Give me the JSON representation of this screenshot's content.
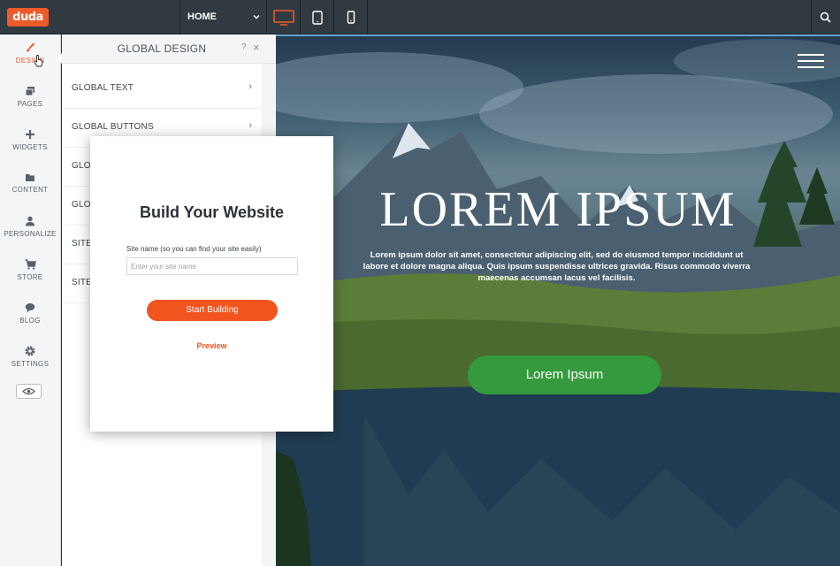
{
  "brand": {
    "logo_text": "duda",
    "accent": "#ef5a2a"
  },
  "topbar": {
    "page_select": "HOME",
    "devices": [
      "desktop-icon",
      "tablet-icon",
      "mobile-icon"
    ],
    "active_device": "desktop"
  },
  "sidebar": {
    "items": [
      {
        "label": "DESIGN",
        "icon": "brush-icon",
        "active": true
      },
      {
        "label": "PAGES",
        "icon": "pages-icon"
      },
      {
        "label": "WIDGETS",
        "icon": "plus-icon"
      },
      {
        "label": "CONTENT",
        "icon": "folder-icon"
      },
      {
        "label": "PERSONALIZE",
        "icon": "person-icon"
      },
      {
        "label": "STORE",
        "icon": "cart-icon"
      },
      {
        "label": "BLOG",
        "icon": "chat-icon"
      },
      {
        "label": "SETTINGS",
        "icon": "gear-icon"
      }
    ]
  },
  "panel": {
    "title": "GLOBAL DESIGN",
    "help": "?",
    "close": "×",
    "rows": [
      "GLOBAL TEXT",
      "GLOBAL BUTTONS",
      "GLOB",
      "GLOB",
      "SITE",
      "SITE"
    ],
    "arrow": "›"
  },
  "modal": {
    "title": "Build Your Website",
    "field_label": "Site name (so you can find your site easily)",
    "field_placeholder": "Enter your site name",
    "start_button": "Start Building",
    "preview_link": "Preview"
  },
  "hero": {
    "title": "LOREM IPSUM",
    "text": "Lorem ipsum dolor sit amet, consectetur adipiscing elit, sed do eiusmod tempor incididunt ut labore et dolore magna aliqua. Quis ipsum suspendisse ultrices gravida. Risus commodo viverra maecenas accumsan lacus vel facilisis.",
    "button": "Lorem Ipsum",
    "button_color": "#349a3d"
  }
}
